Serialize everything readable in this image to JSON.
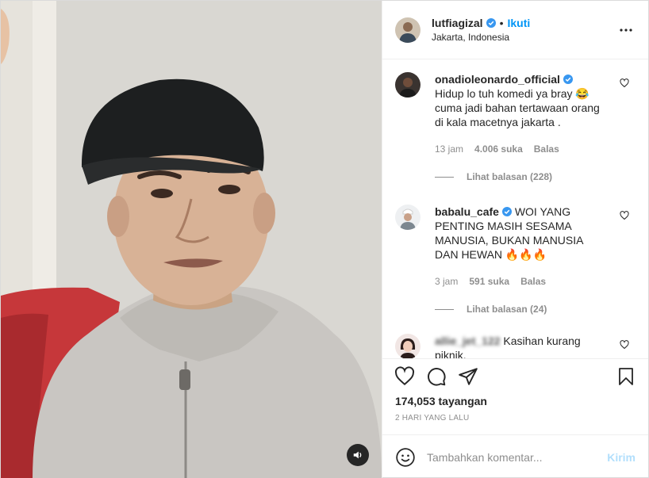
{
  "post": {
    "username": "lutfiagizal",
    "follow_label": "Ikuti",
    "separator": "•",
    "location": "Jakarta, Indonesia",
    "more_icon": "more-horizontal-icon"
  },
  "comments": [
    {
      "username": "onadioleonardo_official",
      "text": "Hidup lo tuh komedi ya bray 😂 cuma jadi bahan tertawaan orang di kala macetnya jakarta .",
      "time": "13 jam",
      "likes": "4.006 suka",
      "reply": "Balas",
      "view_replies": "Lihat balasan (228)"
    },
    {
      "username": "babalu_cafe",
      "text": "WOI YANG PENTING MASIH SESAMA MANUSIA, BUKAN MANUSIA DAN HEWAN 🔥🔥🔥",
      "time": "3 jam",
      "likes": "591 suka",
      "reply": "Balas",
      "view_replies": "Lihat balasan (24)"
    },
    {
      "username_blurred": "allie_jet_122",
      "text": "Kasihan kurang piknik."
    }
  ],
  "stats": {
    "views": "174,053 tayangan",
    "date": "2 HARI YANG LALU"
  },
  "composer": {
    "placeholder": "Tambahkan komentar...",
    "send_label": "Kirim"
  },
  "colors": {
    "link_blue": "#0095f6",
    "send_disabled": "#b2dffc",
    "muted": "#8e8e8e",
    "verified": "#3897f0"
  }
}
